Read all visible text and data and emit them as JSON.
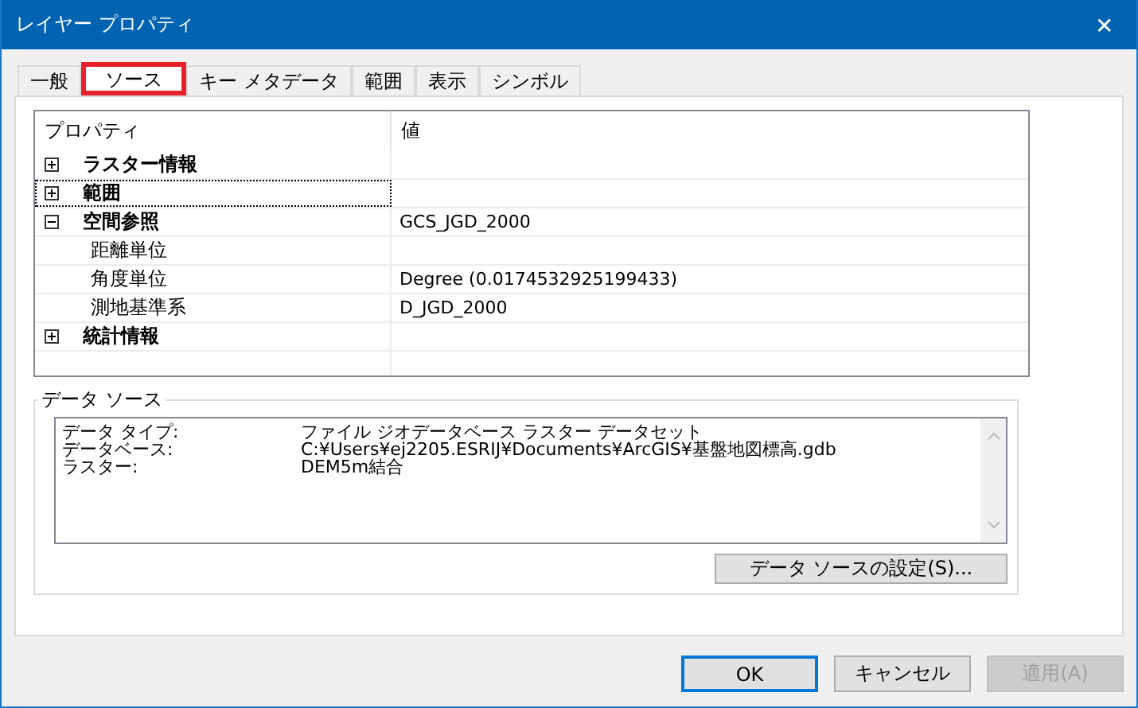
{
  "window": {
    "title": "レイヤー プロパティ",
    "close": "✕"
  },
  "tabs": [
    {
      "label": "一般",
      "selected": false,
      "annotated": false
    },
    {
      "label": "ソース",
      "selected": true,
      "annotated": true
    },
    {
      "label": "キー メタデータ",
      "selected": false,
      "annotated": false
    },
    {
      "label": "範囲",
      "selected": false,
      "annotated": false
    },
    {
      "label": "表示",
      "selected": false,
      "annotated": false
    },
    {
      "label": "シンボル",
      "selected": false,
      "annotated": false
    }
  ],
  "property_grid": {
    "columns": [
      "プロパティ",
      "値"
    ],
    "rows": [
      {
        "name": "ラスター情報",
        "expanded": false,
        "focused": false,
        "children": []
      },
      {
        "name": "範囲",
        "expanded": false,
        "focused": true,
        "children": []
      },
      {
        "name": "空間参照",
        "value": "GCS_JGD_2000",
        "expanded": true,
        "focused": false,
        "children": [
          {
            "name": "距離単位"
          },
          {
            "name": "角度単位",
            "value": "Degree (0.0174532925199433)"
          },
          {
            "name": "測地基準系",
            "value": "D_JGD_2000"
          }
        ]
      },
      {
        "name": "統計情報",
        "expanded": false,
        "focused": false,
        "children": []
      }
    ]
  },
  "data_source": {
    "title": "データ ソース",
    "rows": [
      {
        "label": "データ タイプ:",
        "value": "ファイル ジオデータベース ラスター データセット"
      },
      {
        "label": "データベース:",
        "value": "C:¥Users¥ej2205.ESRIJ¥Documents¥ArcGIS¥基盤地図標高.gdb"
      },
      {
        "label": "ラスター:",
        "value": "DEM5m結合"
      }
    ],
    "button": "データ ソースの設定(S)..."
  },
  "buttons": [
    {
      "label": "OK",
      "default": true,
      "disabled": false
    },
    {
      "label": "キャンセル",
      "default": false,
      "disabled": false
    },
    {
      "label": "適用(A)",
      "default": false,
      "disabled": true
    }
  ]
}
